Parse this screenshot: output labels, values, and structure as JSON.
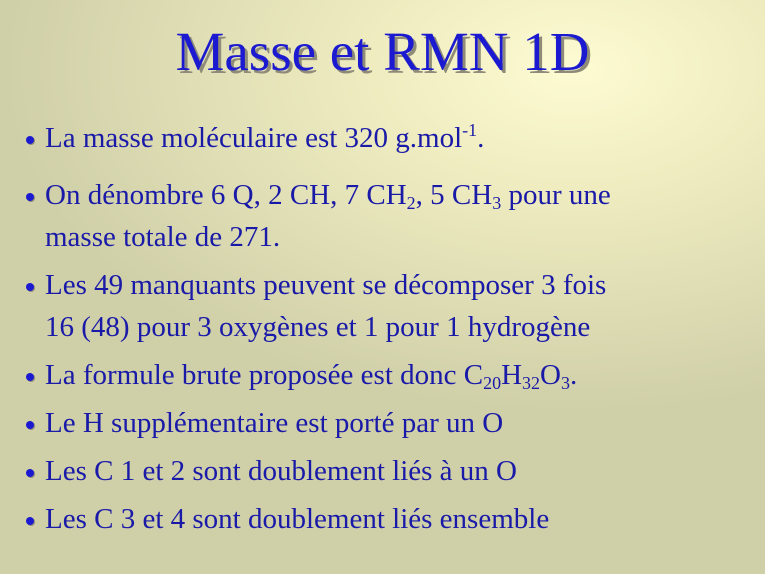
{
  "slide": {
    "title": "Masse et RMN 1D",
    "bullets": [
      {
        "parts": [
          {
            "t": "La masse moléculaire est 320 g.mol"
          },
          {
            "sup": "-1"
          },
          {
            "t": "."
          }
        ]
      },
      {
        "parts": [
          {
            "t": "On dénombre 6 Q, 2 CH, 7 CH"
          },
          {
            "sub": "2"
          },
          {
            "t": ", 5 CH"
          },
          {
            "sub": "3"
          },
          {
            "t": " pour une"
          }
        ],
        "line2": "masse totale de 271."
      },
      {
        "parts": [
          {
            "t": "Les 49 manquants peuvent se décomposer 3 fois"
          }
        ],
        "line2": "16 (48) pour 3 oxygènes et 1 pour 1 hydrogène"
      },
      {
        "parts": [
          {
            "t": "La formule brute proposée est donc C"
          },
          {
            "sub": "20"
          },
          {
            "t": "H"
          },
          {
            "sub": "32"
          },
          {
            "t": "O"
          },
          {
            "sub": "3"
          },
          {
            "t": "."
          }
        ]
      },
      {
        "parts": [
          {
            "t": "Le H supplémentaire est porté par un O"
          }
        ]
      },
      {
        "parts": [
          {
            "t": "Les C 1 et 2 sont doublement liés à un O"
          }
        ]
      },
      {
        "parts": [
          {
            "t": "Les C 3 et 4 sont doublement liés ensemble"
          }
        ]
      }
    ]
  },
  "colors": {
    "text": "#1a1aa8",
    "title": "#1c1ad0",
    "shadow": "#8e8c78",
    "background": "#e8e6bb"
  }
}
